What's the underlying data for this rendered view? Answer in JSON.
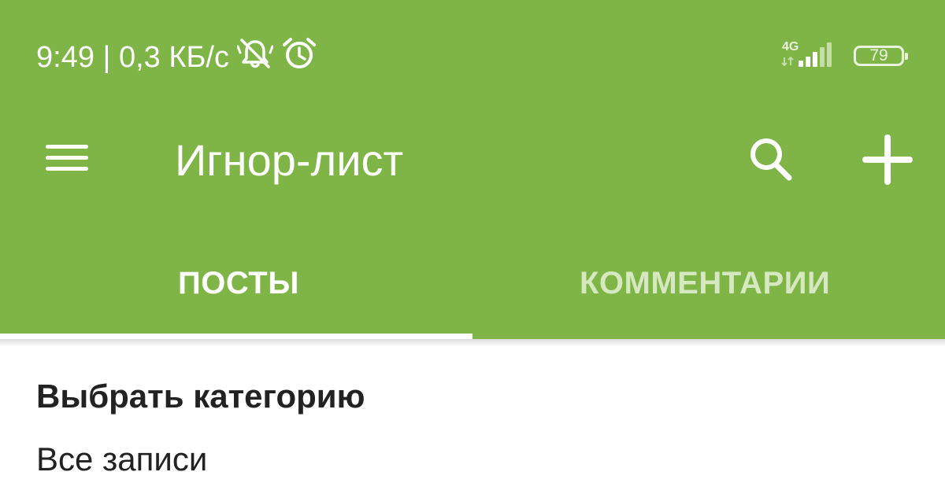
{
  "status_bar": {
    "time_speed": "9:49 | 0,3 КБ/с",
    "network": "4G",
    "battery_level": "79",
    "icons": [
      "bell-muted-icon",
      "alarm-icon",
      "signal-icon",
      "battery-icon"
    ]
  },
  "toolbar": {
    "title": "Игнор-лист",
    "icons": [
      "menu-icon",
      "search-icon",
      "add-icon"
    ]
  },
  "tabs": [
    {
      "label": "ПОСТЫ",
      "selected": true
    },
    {
      "label": "КОММЕНТАРИИ",
      "selected": false
    }
  ],
  "content": {
    "section_title": "Выбрать категорию",
    "items": [
      {
        "label": "Все записи"
      }
    ]
  },
  "colors": {
    "accent": "#7fb446",
    "tab_active": "#ffffff",
    "tab_inactive": "#d6e8bf",
    "text": "#222222"
  }
}
